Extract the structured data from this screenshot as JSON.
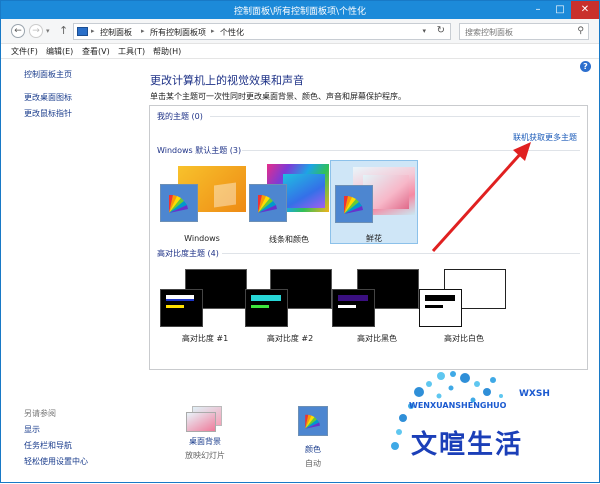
{
  "window": {
    "title": "控制面板\\所有控制面板项\\个性化",
    "min_icon": "minimize-icon",
    "max_icon": "maximize-icon",
    "close_icon": "close-icon"
  },
  "address": {
    "crumbs": [
      "控制面板",
      "所有控制面板项",
      "个性化"
    ],
    "search_placeholder": "搜索控制面板"
  },
  "menu": [
    "文件(F)",
    "编辑(E)",
    "查看(V)",
    "工具(T)",
    "帮助(H)"
  ],
  "left_nav": {
    "links": [
      "控制面板主页",
      "更改桌面图标",
      "更改鼠标指针"
    ],
    "see_also_title": "另请参阅",
    "see_also": [
      "显示",
      "任务栏和导航",
      "轻松使用设置中心"
    ]
  },
  "main": {
    "heading": "更改计算机上的视觉效果和声音",
    "subheading": "单击某个主题可一次性同时更改桌面背景、颜色、声音和屏幕保护程序。",
    "my_themes": "我的主题 (0)",
    "online_link": "联机获取更多主题",
    "default_section": "Windows 默认主题 (3)",
    "default_themes": [
      "Windows",
      "线条和颜色",
      "鲜花"
    ],
    "selected_theme": "鲜花",
    "hc_section": "高对比度主题 (4)",
    "hc_themes": [
      "高对比度 #1",
      "高对比度 #2",
      "高对比黑色",
      "高对比白色"
    ]
  },
  "bottom": {
    "background_title": "桌面背景",
    "background_sub": "放映幻灯片",
    "color_title": "颜色",
    "color_sub": "自动"
  },
  "watermark": {
    "brand": "文暄生活",
    "sub": "WENXUANSHENGHUO",
    "top": "WXSH"
  },
  "colors": {
    "titlebar": "#1c8ad9",
    "link": "#1a3c8c",
    "selected_bg": "#cfe6f7",
    "arrow": "#e02020"
  }
}
